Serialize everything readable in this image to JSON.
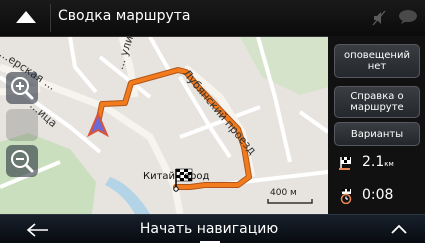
{
  "topbar": {
    "title": "Сводка маршрута",
    "back_icon": "up-arrow-icon",
    "mute_icon": "mute-icon",
    "messages_icon": "message-icon"
  },
  "map": {
    "streets": [
      "...ерская ...",
      "... улица",
      "Лубянский проезд",
      "...ица"
    ],
    "destination_label": "Китай-город",
    "scale_label": "400 м",
    "controls": [
      "zoom-in",
      "2d-view",
      "zoom-out"
    ],
    "route_color": "#f27b1d"
  },
  "panel": {
    "alerts_label": "оповещений нет",
    "summary_label": "Справка о маршруте",
    "variants_label": "Варианты",
    "distance_value": "2.1",
    "distance_unit": "км",
    "time_value": "0:08"
  },
  "bottombar": {
    "start_label": "Начать навигацию",
    "back_icon": "left-arrow-icon",
    "expand_icon": "chevron-up-icon"
  }
}
